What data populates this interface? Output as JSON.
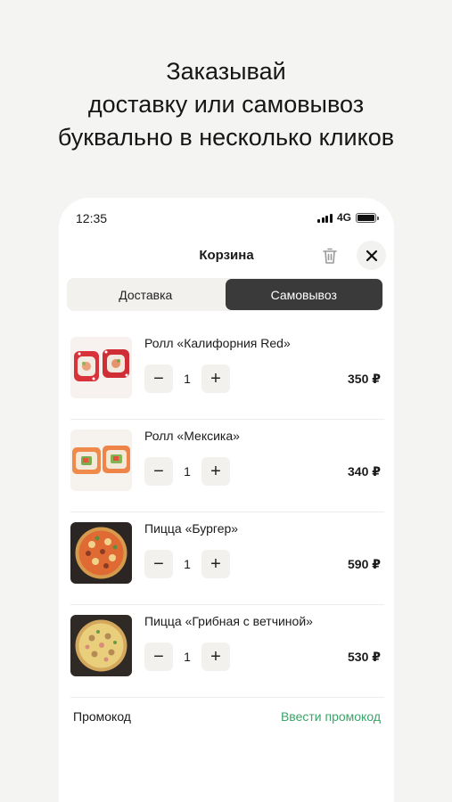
{
  "headline": [
    "Заказывай",
    "доставку или самовывоз",
    "буквально в несколько кликов"
  ],
  "status": {
    "time": "12:35",
    "network": "4G"
  },
  "cart": {
    "title": "Корзина",
    "tabs": [
      {
        "label": "Доставка",
        "active": false
      },
      {
        "label": "Самовывоз",
        "active": true
      }
    ],
    "items": [
      {
        "name": "Ролл «Калифорния Red»",
        "qty": "1",
        "price": "350 ₽",
        "image": "roll-red"
      },
      {
        "name": "Ролл «Мексика»",
        "qty": "1",
        "price": "340 ₽",
        "image": "roll-mexico"
      },
      {
        "name": "Пицца «Бургер»",
        "qty": "1",
        "price": "590 ₽",
        "image": "pizza-burger"
      },
      {
        "name": "Пицца «Грибная с ветчиной»",
        "qty": "1",
        "price": "530 ₽",
        "image": "pizza-mushroom"
      }
    ],
    "promo": {
      "label": "Промокод",
      "link": "Ввести промокод"
    }
  },
  "colors": {
    "accent_green": "#3aa568",
    "active_tab": "#3a3a3a",
    "background": "#f4f4f3"
  }
}
